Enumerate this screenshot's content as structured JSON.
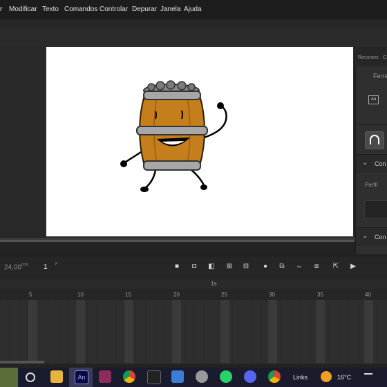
{
  "menu": {
    "items": [
      "r",
      "Modificar",
      "Texto",
      "Comandos",
      "Controlar",
      "Depurar",
      "Janela",
      "Ajuda"
    ]
  },
  "right_panel": {
    "tab_recursos": "Recursos",
    "tab_partial": "C",
    "tool_partial": "Ferra",
    "an_badge": "An",
    "section1": "Con",
    "perfil_label": "Perfil",
    "section2": "Con",
    "chevron": "⌄"
  },
  "timeline": {
    "fps_value": "24,00",
    "fps_unit": "FPS",
    "current_frame": "1",
    "frame_unit": "F",
    "seconds_marker": "1s",
    "frame_labels": [
      "5",
      "10",
      "15",
      "20",
      "25",
      "30",
      "35",
      "40"
    ]
  },
  "taskbar": {
    "links_label": "Links",
    "temperature": "16°C",
    "an_label": "An"
  },
  "colors": {
    "stage": "#ffffff",
    "menubar": "#1d1d1d",
    "taskbar": "#1b1b2e",
    "barrel_wood": "#c47f1c",
    "barrel_band": "#a7a7a7"
  }
}
